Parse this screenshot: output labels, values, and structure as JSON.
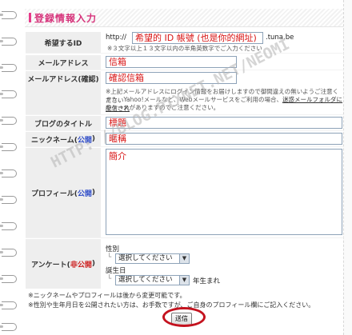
{
  "header": {
    "title": "登録情報入力"
  },
  "fields": {
    "blog_id": {
      "label": "希望するID",
      "prefix": "http://",
      "value": "希望的 ID 帳號 (也是你的網址)",
      "suffix": ".tuna.be",
      "note": "※３文字以上１３文字以内の半角英数字でご入力ください"
    },
    "email": {
      "label": "メールアドレス",
      "value": "信箱"
    },
    "email_confirm": {
      "label": "メールアドレス(確認)",
      "value": "確認信箱",
      "note_line1": "※上記メールアドレスにログイン情報をお届けしますので御間違えの無いようご注意ください",
      "note_line2_pre": "また、Yahoo!メールなど、Webメールサービスをご利用の場合、",
      "note_line2_link": "迷惑メールフォルダに配信され",
      "note_line3": "るケースがありますのでご注意ください。"
    },
    "blog_title": {
      "label": "ブログのタイトル",
      "value": "標題"
    },
    "nickname": {
      "label_main": "ニックネーム(",
      "label_pub": "公開",
      "label_end": ")",
      "value": "暱稱"
    },
    "profile": {
      "label_main": "プロフィール(",
      "label_pub": "公開",
      "label_end": ")",
      "value": "簡介"
    },
    "survey": {
      "label_main": "アンケート(",
      "label_priv": "非公開",
      "label_end": ")",
      "gender_label": "性別",
      "gender_select": "選択してください",
      "birth_label": "誕生日",
      "birth_select": "選択してください",
      "birth_suffix": "年生まれ"
    }
  },
  "footnotes": {
    "line1": "※ニックネームやプロフィールは後から変更可能です。",
    "line2": "※性別や生年月日を公開されたい方は、お手数ですが、ご自身のプロフィール欄にご記入ください。"
  },
  "submit_label": "送信",
  "watermark": "HTTP: //BLOG.PIXNET.NET/NEOMI",
  "colors": {
    "accent": "#d6327a",
    "input_text": "#d81414",
    "public": "#2b49c7",
    "private": "#cc1b1b",
    "highlight_circle": "#c4121e"
  }
}
